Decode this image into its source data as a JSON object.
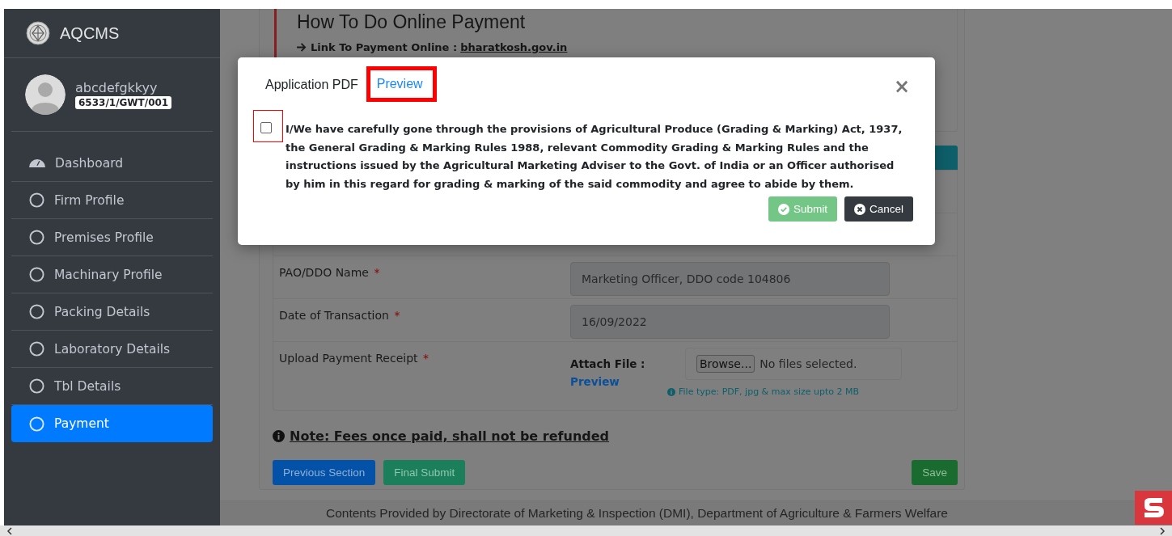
{
  "brand": {
    "name": "AQCMS"
  },
  "user": {
    "name": "abcdefgkkyy",
    "code": "6533/1/GWT/001"
  },
  "sidebar": {
    "items": [
      {
        "label": "Dashboard",
        "kind": "home",
        "selected": false
      },
      {
        "label": "Firm Profile",
        "kind": "step",
        "selected": false
      },
      {
        "label": "Premises Profile",
        "kind": "step",
        "selected": false
      },
      {
        "label": "Machinary Profile",
        "kind": "step",
        "selected": false
      },
      {
        "label": "Packing Details",
        "kind": "step",
        "selected": false
      },
      {
        "label": "Laboratory Details",
        "kind": "step",
        "selected": false
      },
      {
        "label": "Tbl Details",
        "kind": "step",
        "selected": false
      },
      {
        "label": "Payment",
        "kind": "step",
        "selected": true
      }
    ]
  },
  "page": {
    "heading": "How To Do Online Payment",
    "link_label": "Link To Payment Online :",
    "link": "bharatkosh.gov.in",
    "rows": [
      {
        "kind": "text",
        "label": "PAO/DDO Name",
        "mark": "*",
        "value": "Marketing Officer, DDO code 104806"
      },
      {
        "kind": "text",
        "label": "Date of Transaction",
        "mark": "*",
        "value": "16/09/2022"
      },
      {
        "kind": "file",
        "label": "Upload Payment Receipt",
        "mark": "*",
        "attach_label": "Attach File :",
        "preview": "Preview",
        "browse": "Browse...",
        "file_status": "No files selected.",
        "hint": "File type: PDF, jpg & max size upto 2 MB"
      }
    ],
    "note": "Note: Fees once paid, shall not be refunded",
    "buttons": [
      {
        "label": "Previous Section",
        "kind": "primary"
      },
      {
        "label": "Final Submit",
        "kind": "success"
      },
      {
        "label": "Save",
        "kind": "save"
      }
    ]
  },
  "footer": "Contents Provided by Directorate of Marketing & Inspection (DMI), Department of Agriculture & Farmers Welfare",
  "modal": {
    "title": "Application PDF",
    "preview": {
      "label": "Preview",
      "highlighted": true
    },
    "close": "×",
    "declaration": {
      "checked": false,
      "highlighted": true,
      "text": "I/We have carefully gone through the provisions of Agricultural Produce (Grading & Marking) Act, 1937, the General Grading & Marking Rules 1988, relevant Commodity Grading & Marking Rules and the instructions issued by the Agricultural Marketing Adviser to the Govt. of India or an Officer authorised by him in this regard for grading & marking of the said commodity and agree to abide by them."
    },
    "buttons": [
      {
        "label": "Submit",
        "kind": "submit",
        "disabled": true
      },
      {
        "label": "Cancel",
        "kind": "cancel",
        "disabled": false
      }
    ]
  }
}
